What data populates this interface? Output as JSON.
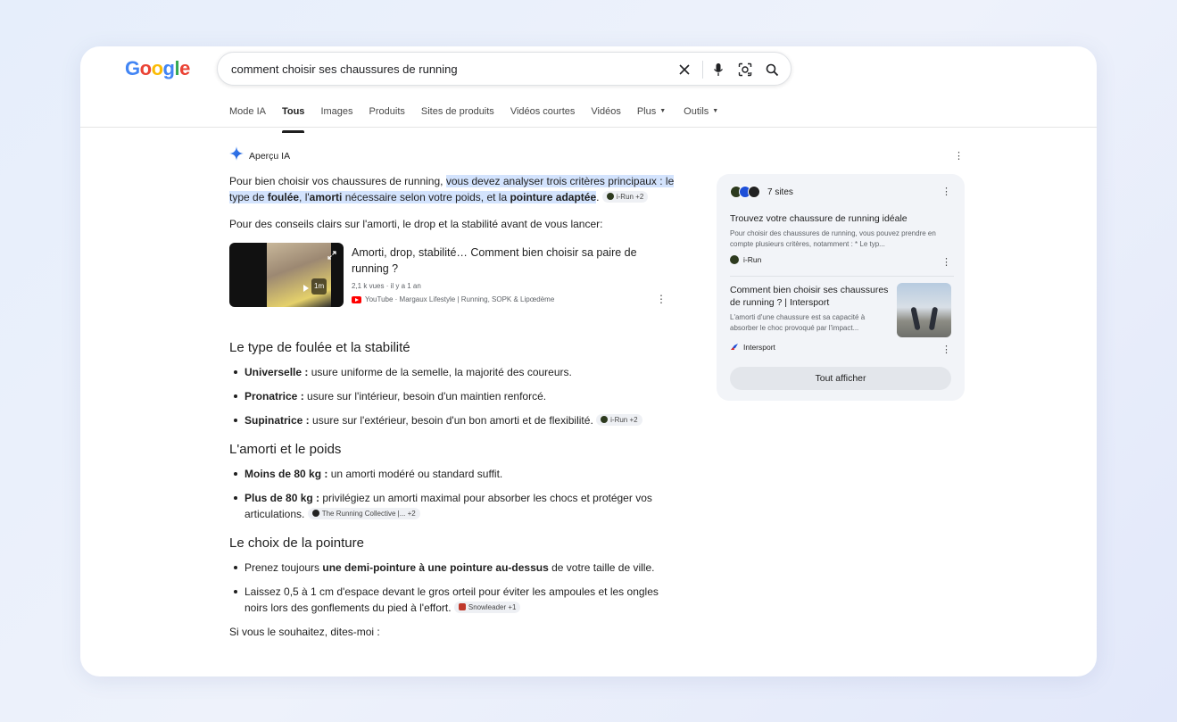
{
  "header": {
    "logo": [
      "G",
      "o",
      "o",
      "g",
      "l",
      "e"
    ],
    "logo_colors": [
      "#4285F4",
      "#EA4335",
      "#FBBC05",
      "#4285F4",
      "#34A853",
      "#EA4335"
    ],
    "query": "comment choisir ses chaussures de running"
  },
  "icons": {
    "clear": "close-icon",
    "voice": "microphone-icon",
    "lens": "camera-lens-icon",
    "search": "search-icon",
    "ai": "sparkle-icon"
  },
  "tabs": [
    {
      "label": "Mode IA"
    },
    {
      "label": "Tous",
      "active": true
    },
    {
      "label": "Images"
    },
    {
      "label": "Produits"
    },
    {
      "label": "Sites de produits"
    },
    {
      "label": "Vidéos courtes"
    },
    {
      "label": "Vidéos"
    },
    {
      "label": "Plus"
    },
    {
      "label": "Outils"
    }
  ],
  "ai": {
    "header": "Aperçu IA",
    "intro": {
      "plain": "Pour bien choisir vos chaussures de running, ",
      "hl1": "vous devez analyser trois critères principaux : le type de ",
      "b1": "foulée",
      "hl2": ", l'",
      "b2": "amorti",
      "hl3": " nécessaire selon votre poids, et la ",
      "b3": "pointure adaptée",
      "end": ".",
      "chip": "i-Run +2"
    },
    "lead": "Pour des conseils clairs sur l'amorti, le drop et la stabilité avant de vous lancer:",
    "video": {
      "title": "Amorti, drop, stabilité… Comment bien choisir sa paire de running ?",
      "meta": "2,1 k vues · il y a 1 an",
      "source": "YouTube · Margaux Lifestyle | Running, SOPK & Lipœdème",
      "duration": "1m"
    },
    "s1": {
      "title": "Le type de foulée et la stabilité",
      "items": [
        {
          "b": "Universelle :",
          "t": " usure uniforme de la semelle, la majorité des coureurs."
        },
        {
          "b": "Pronatrice :",
          "t": " usure sur l'intérieur, besoin d'un maintien renforcé."
        },
        {
          "b": "Supinatrice :",
          "t": " usure sur l'extérieur, besoin d'un bon amorti et de flexibilité.",
          "chip": "i-Run +2"
        }
      ]
    },
    "s2": {
      "title": "L'amorti et le poids",
      "items": [
        {
          "b": "Moins de 80 kg :",
          "t": " un amorti modéré ou standard suffit."
        },
        {
          "b": "Plus de 80 kg :",
          "t": " privilégiez un amorti maximal pour absorber les chocs et protéger vos articulations.",
          "chip": "The Running Collective |... +2"
        }
      ]
    },
    "s3": {
      "title": "Le choix de la pointure",
      "items": [
        {
          "t1": "Prenez toujours ",
          "b": "une demi-pointure à une pointure au-dessus",
          "t2": " de votre taille de ville."
        },
        {
          "t1": "Laissez 0,5 à 1 cm d'espace devant le gros orteil pour éviter les ampoules et les ongles noirs lors des gonflements du pied à l'effort.",
          "chip": "Snowleader +1"
        }
      ]
    },
    "ending": "Si vous le souhaitez, dites-moi :"
  },
  "sources": {
    "count": "7 sites",
    "card1": {
      "title": "Trouvez votre chaussure de running idéale",
      "snippet": "Pour choisir des chaussures de running, vous pouvez prendre en compte plusieurs critères, notamment : * Le typ...",
      "site": "i-Run"
    },
    "card2": {
      "title": "Comment bien choisir ses chaussures de running ? | Intersport",
      "snippet": "L'amorti d'une chaussure est sa capacité à absorber le choc provoqué par l'impact...",
      "site": "Intersport"
    },
    "show_all": "Tout afficher"
  }
}
